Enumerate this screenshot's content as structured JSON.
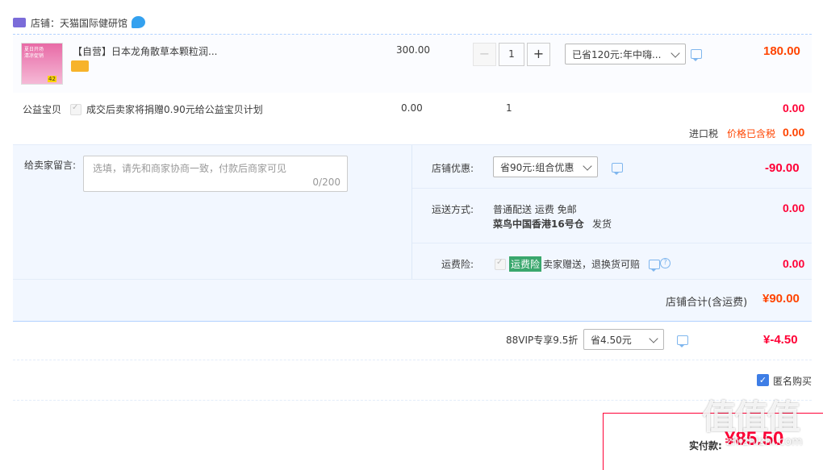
{
  "shop": {
    "label": "店铺：天猫国际健研馆"
  },
  "item": {
    "thumb_lines": [
      "夏日开场",
      "清凉促销",
      "42"
    ],
    "title": "【自营】日本龙角散草本颗粒润...",
    "unit_price": "300.00",
    "quantity": "1",
    "promo_select": "已省120元:年中嗨...",
    "subtotal": "180.00"
  },
  "charity": {
    "label": "公益宝贝",
    "text": "成交后卖家将捐赠0.90元给公益宝贝计划",
    "price": "0.00",
    "quantity": "1",
    "subtotal": "0.00"
  },
  "import_tax": {
    "label": "进口税",
    "note": "价格已含税",
    "value": "0.00"
  },
  "message": {
    "label": "给卖家留言:",
    "placeholder": "选填，请先和商家协商一致，付款后商家可见",
    "counter": "0/200"
  },
  "shop_discount": {
    "label": "店铺优惠:",
    "select": "省90元:组合优惠",
    "value": "-90.00"
  },
  "shipping": {
    "label": "运送方式:",
    "line1": "普通配送 运费 免邮",
    "line2_bold": "菜鸟中国香港16号仓",
    "line2_rest": "发货",
    "value": "0.00"
  },
  "insurance": {
    "label": "运费险:",
    "badge": "运费险",
    "text": "卖家赠送，退换货可赔",
    "value": "0.00"
  },
  "shop_total": {
    "label": "店铺合计(含运费)",
    "value": "¥90.00"
  },
  "vip": {
    "label": "88VIP专享9.5折",
    "select": "省4.50元",
    "value": "¥-4.50"
  },
  "anonymous": {
    "label": "匿名购买"
  },
  "payment": {
    "label": "实付款:",
    "amount": "¥85.50"
  },
  "watermark": {
    "text": "值值值",
    "site": "zhizhizhi.com"
  },
  "colors": {
    "accent_red": "#ff0036",
    "price_orange": "#f40",
    "border_blue": "#b2d1ff",
    "panel_bg": "#f2f7ff"
  }
}
